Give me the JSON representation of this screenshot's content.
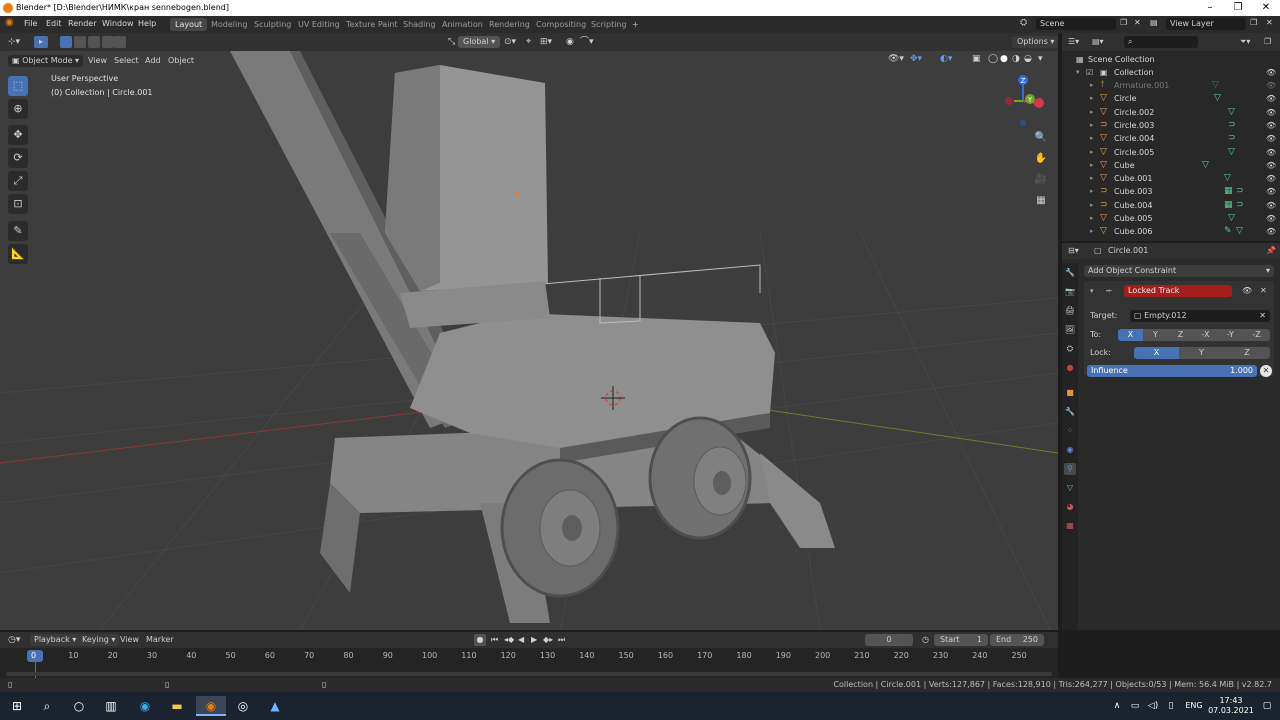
{
  "window": {
    "title": "Blender* [D:\\Blender\\НИМК\\кран sennebogen.blend]"
  },
  "menu": [
    "File",
    "Edit",
    "Render",
    "Window",
    "Help"
  ],
  "workspaces": [
    "Layout",
    "Modeling",
    "Sculpting",
    "UV Editing",
    "Texture Paint",
    "Shading",
    "Animation",
    "Rendering",
    "Compositing",
    "Scripting"
  ],
  "scene": {
    "name": "Scene",
    "view_layer": "View Layer"
  },
  "viewport": {
    "mode": "Object Mode",
    "menus": [
      "View",
      "Select",
      "Add",
      "Object"
    ],
    "transform_orientation": "Global",
    "options_label": "Options",
    "perspective_label": "User Perspective",
    "collection_label": "(0) Collection | Circle.001",
    "gizmo": {
      "x": "X",
      "y": "Y",
      "z": "Z"
    }
  },
  "outliner": {
    "root": "Scene Collection",
    "collection": "Collection",
    "items": [
      {
        "name": "Armature.001",
        "icon": "armature-icon",
        "dim": true
      },
      {
        "name": "Circle",
        "icon": "mesh-icon"
      },
      {
        "name": "Circle.002",
        "icon": "mesh-icon"
      },
      {
        "name": "Circle.003",
        "icon": "curve-icon"
      },
      {
        "name": "Circle.004",
        "icon": "mesh-icon"
      },
      {
        "name": "Circle.005",
        "icon": "mesh-icon"
      },
      {
        "name": "Cube",
        "icon": "mesh-icon"
      },
      {
        "name": "Cube.001",
        "icon": "mesh-icon"
      },
      {
        "name": "Cube.003",
        "icon": "curve-icon"
      },
      {
        "name": "Cube.004",
        "icon": "curve-icon"
      },
      {
        "name": "Cube.005",
        "icon": "mesh-icon"
      },
      {
        "name": "Cube.006",
        "icon": "mesh-icon"
      }
    ]
  },
  "properties": {
    "object_name": "Circle.001",
    "add_constraint_label": "Add Object Constraint",
    "constraint": {
      "name": "Locked Track",
      "target_label": "Target:",
      "target_value": "Empty.012",
      "to_label": "To:",
      "to_axes": [
        "X",
        "Y",
        "Z",
        "-X",
        "-Y",
        "-Z"
      ],
      "lock_label": "Lock:",
      "lock_axes": [
        "X",
        "Y",
        "Z"
      ],
      "influence_label": "Influence",
      "influence_value": "1.000"
    }
  },
  "timeline": {
    "menus": [
      "Playback",
      "Keying",
      "View",
      "Marker"
    ],
    "current_frame": "0",
    "start_label": "Start",
    "start_value": "1",
    "end_label": "End",
    "end_value": "250",
    "ticks": [
      "0",
      "10",
      "20",
      "30",
      "40",
      "50",
      "60",
      "70",
      "80",
      "90",
      "100",
      "110",
      "120",
      "130",
      "140",
      "150",
      "160",
      "170",
      "180",
      "190",
      "200",
      "210",
      "220",
      "230",
      "240",
      "250"
    ]
  },
  "statusbar": {
    "text": "Collection | Circle.001 | Verts:127,867 | Faces:128,910 | Tris:264,277 | Objects:0/53 | Mem: 56.4 MiB | v2.82.7"
  },
  "taskbar": {
    "lang": "ENG",
    "time": "17:43",
    "date": "07.03.2021"
  },
  "colors": {
    "accent": "#4772b3",
    "constraint_red": "#a61d1d",
    "viewport_bg": "#3d3d3d",
    "active_orange": "#e87d0d"
  }
}
